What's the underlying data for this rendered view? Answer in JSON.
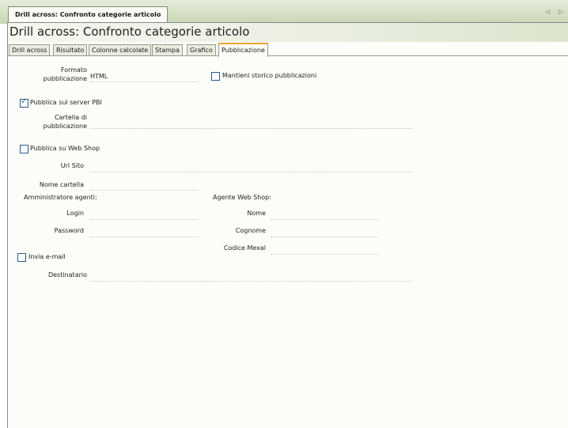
{
  "window": {
    "doc_tab": "Drill across: Confronto categorie articolo",
    "title": "Drill across: Confronto categorie articolo",
    "scroll_arrows": "◁ ▷"
  },
  "tabs": [
    {
      "label": "Drill across"
    },
    {
      "label": "Risultato"
    },
    {
      "label": "Colonne calcolate"
    },
    {
      "label": "Stampa"
    },
    {
      "label": "Grafico"
    },
    {
      "label": "Pubblicazione"
    }
  ],
  "form": {
    "formato_label_1": "Formato",
    "formato_label_2": "pubblicazione",
    "formato_value": "HTML",
    "storico_label": "Mantieni storico pubblicazioni",
    "storico_checked": false,
    "pbi_label": "Pubblica sul server PBI",
    "pbi_checked": true,
    "cartella_label_1": "Cartella di",
    "cartella_label_2": "pubblicazione",
    "cartella_value": "",
    "webshop_label": "Pubblica su Web Shop",
    "webshop_checked": false,
    "url_label": "Url Sito",
    "url_value": "",
    "nome_cartella_label": "Nome cartella",
    "nome_cartella_value": "",
    "admin_header": "Amministratore agenti:",
    "login_label": "Login",
    "login_value": "",
    "password_label": "Password",
    "password_value": "",
    "agente_header": "Agente Web Shop:",
    "nome_label": "Nome",
    "nome_value": "",
    "cognome_label": "Cognome",
    "cognome_value": "",
    "codice_label": "Codice Mexal",
    "codice_value": "",
    "email_label": "Invia e-mail",
    "email_checked": false,
    "destinatario_label": "Destinatario",
    "destinatario_value": ""
  }
}
